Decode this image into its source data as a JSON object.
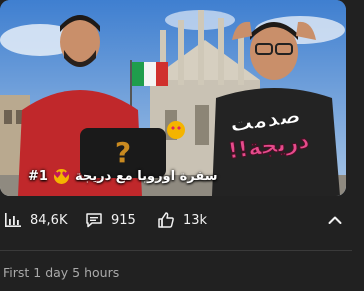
{
  "thumbnail": {
    "caption_episode": "#1",
    "caption_emoji": "heart-eyes-emoji",
    "caption_text": "سفرة اوروبا مع دريجة",
    "overlay_line1": "صدمت",
    "overlay_line2": "دريجة!!",
    "mystery_mark": "?"
  },
  "stats": {
    "views": "84,6K",
    "comments": "915",
    "likes": "13k"
  },
  "footer": {
    "first_stat": "First 1 day 5 hours"
  }
}
